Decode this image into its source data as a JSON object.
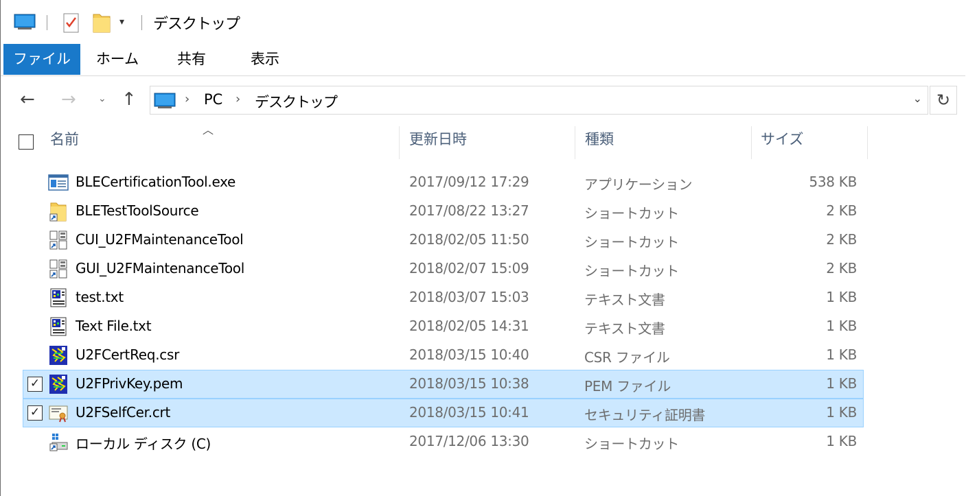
{
  "window": {
    "title": "デスクトップ",
    "qat_dropdown_icon": "customize-qat-icon"
  },
  "ribbon": {
    "tabs": [
      "ファイル",
      "ホーム",
      "共有",
      "表示"
    ]
  },
  "address": {
    "crumbs": [
      "PC",
      "デスクトップ"
    ]
  },
  "columns": {
    "name": "名前",
    "modified": "更新日時",
    "type": "種類",
    "size": "サイズ"
  },
  "files": [
    {
      "name": "BLECertificationTool.exe",
      "modified": "2017/09/12 17:29",
      "type": "アプリケーション",
      "size": "538 KB",
      "icon": "application-icon",
      "selected": false
    },
    {
      "name": "BLETestToolSource",
      "modified": "2017/08/22 13:27",
      "type": "ショートカット",
      "size": "2 KB",
      "icon": "folder-shortcut-icon",
      "selected": false
    },
    {
      "name": "CUI_U2FMaintenanceTool",
      "modified": "2018/02/05 11:50",
      "type": "ショートカット",
      "size": "2 KB",
      "icon": "app-shortcut-icon",
      "selected": false
    },
    {
      "name": "GUI_U2FMaintenanceTool",
      "modified": "2018/02/07 15:09",
      "type": "ショートカット",
      "size": "2 KB",
      "icon": "app-shortcut-icon",
      "selected": false
    },
    {
      "name": "test.txt",
      "modified": "2018/03/07 15:03",
      "type": "テキスト文書",
      "size": "1 KB",
      "icon": "text-file-icon",
      "selected": false
    },
    {
      "name": "Text File.txt",
      "modified": "2018/02/05 14:31",
      "type": "テキスト文書",
      "size": "1 KB",
      "icon": "text-file-icon",
      "selected": false
    },
    {
      "name": "U2FCertReq.csr",
      "modified": "2018/03/15 10:40",
      "type": "CSR ファイル",
      "size": "1 KB",
      "icon": "unknown-file-icon",
      "selected": false
    },
    {
      "name": "U2FPrivKey.pem",
      "modified": "2018/03/15 10:38",
      "type": "PEM ファイル",
      "size": "1 KB",
      "icon": "unknown-file-icon",
      "selected": true
    },
    {
      "name": "U2FSelfCer.crt",
      "modified": "2018/03/15 10:41",
      "type": "セキュリティ証明書",
      "size": "1 KB",
      "icon": "certificate-icon",
      "selected": true
    },
    {
      "name": "ローカル ディスク (C)",
      "modified": "2017/12/06 13:30",
      "type": "ショートカット",
      "size": "1 KB",
      "icon": "drive-shortcut-icon",
      "selected": false
    }
  ]
}
